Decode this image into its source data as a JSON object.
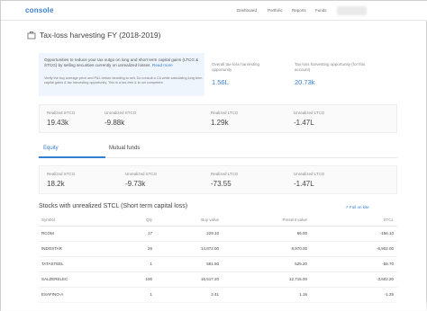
{
  "header": {
    "logo": "console",
    "nav": [
      "Dashboard",
      "Portfolio",
      "Reports",
      "Funds"
    ]
  },
  "page": {
    "title": "Tax-loss harvesting FY (2018-2019)",
    "title_icon": "briefcase-icon"
  },
  "info": {
    "message": "Opportunities to reduce your tax outgo on long and short term capital gains (LTCG & STCG) by selling securities currently on unrealized losses.",
    "read_more": "Read more",
    "note": "Verify the buy average price and P&L before deciding to sell. Do consult a CA while calculating long term capital gains & tax harvesting opportunity. This is a tax-free & is not competent."
  },
  "overview": {
    "tax_label": "Overall tax-loss harvesting opportunity",
    "tax_value": "1.56L",
    "account_label": "Tax-loss harvesting opportunity (for this account)",
    "account_value": "20.73k"
  },
  "summary": [
    {
      "label": "Realized STCG",
      "value": "19.43k"
    },
    {
      "label": "Unrealized STCG",
      "value": "-9.88k"
    },
    {
      "label": "Realized LTCG",
      "value": "1.29k"
    },
    {
      "label": "Unrealized LTCG",
      "value": "-1.47L"
    }
  ],
  "tabs": [
    "Equity",
    "Mutual funds"
  ],
  "equity_summary": [
    {
      "label": "Realized STCG",
      "value": "18.2k"
    },
    {
      "label": "Unrealized STCG",
      "value": "-9.73k"
    },
    {
      "label": "Realized LTCG",
      "value": "-73.55"
    },
    {
      "label": "Unrealized LTCG",
      "value": "-1.47L"
    }
  ],
  "stocks": {
    "title": "Stocks with unrealized STCL (Short term capital loss)",
    "full_link": "Full on kite",
    "columns": [
      "Symbol",
      "Qty",
      "Buy value",
      "Present value",
      "STCL"
    ],
    "rows": [
      [
        "RCOM",
        "17",
        "229.10",
        "66.00",
        "-156.10"
      ],
      [
        "INDOSTAR",
        "26",
        "14,872.00",
        "8,970.00",
        "-5,902.00"
      ],
      [
        "TATASTEEL",
        "1",
        "581.50",
        "525.20",
        "-56.70"
      ],
      [
        "SALZERELEC",
        "100",
        "16,517.20",
        "12,715.00",
        "-3,602.20"
      ],
      [
        "ESAFINO-A",
        "1",
        "2.41",
        "1.16",
        "-1.25"
      ]
    ]
  },
  "colors": {
    "accent": "#387ed1",
    "info_bg": "#eef5fd"
  }
}
